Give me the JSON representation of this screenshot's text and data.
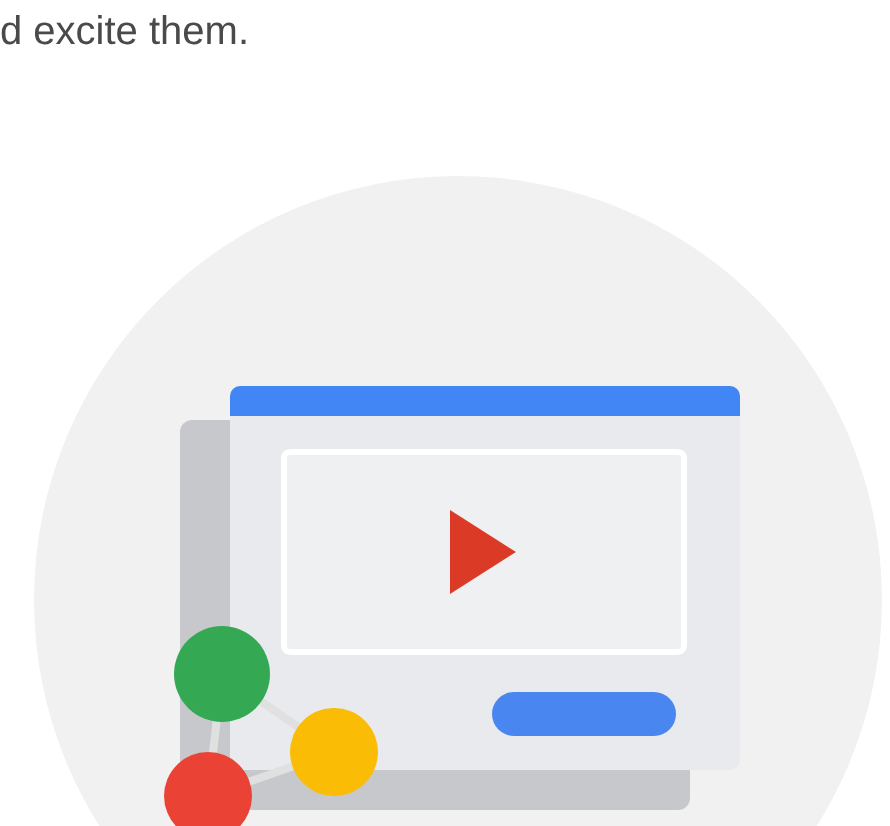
{
  "paragraph_end": "d excite them."
}
